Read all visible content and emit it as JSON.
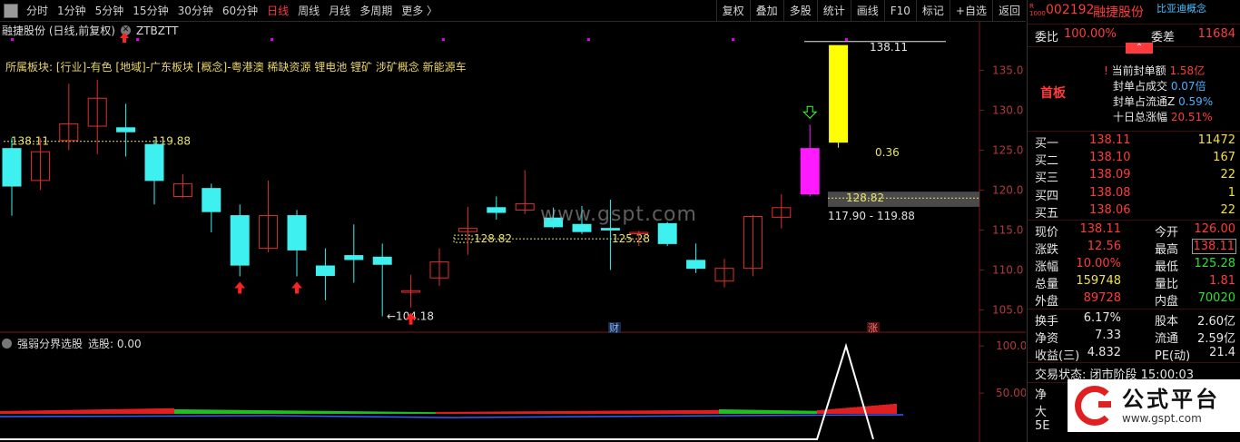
{
  "toolbar": {
    "periods": [
      "分时",
      "1分钟",
      "5分钟",
      "15分钟",
      "30分钟",
      "60分钟",
      "日线",
      "周线",
      "月线",
      "多周期",
      "更多 〉"
    ],
    "active_period": "日线",
    "tools": [
      "复权",
      "叠加",
      "多股",
      "统计",
      "画线",
      "F10",
      "标记",
      "+自选",
      "返回"
    ]
  },
  "chart": {
    "title": "融捷股份 (日线,前复权)",
    "indicator": "ZTBZTT",
    "blocks_text": "所属板块: [行业]-有色 [地域]-广东板块 [概念]-粤港澳 稀缺资源 锂电池 锂矿 涉矿概念 新能源车",
    "price_axis": [
      "135.0",
      "130.0",
      "125.0",
      "120.0",
      "115.0",
      "110.0",
      "105.0"
    ],
    "annotations": {
      "line_left_price": "138.11",
      "line_left_value": "119.88",
      "low_label": "←104.18",
      "mid_low": "128.82",
      "mid_high": "125.28",
      "band_price": "128.82",
      "band_range": "117.90 - 119.88",
      "top_label": "138.11",
      "gap_value": "0.36",
      "event_cai": "财",
      "event_zhang": "涨"
    },
    "watermark": "www.gspt.com"
  },
  "subchart": {
    "title": "强弱分界选股",
    "value_label": "选股: 0.00",
    "axis": [
      "100.0",
      "50.00"
    ]
  },
  "stock": {
    "code": "002192",
    "name": "融捷股份",
    "concept": "比亚迪概念",
    "badge": "R 1000",
    "weibi_label": "委比",
    "weibi": "100.00%",
    "weicha_label": "委差",
    "weicha": "11684",
    "limit_tag": "首板",
    "seal_amount_label": "当前封单额",
    "seal_amount": "1.58亿",
    "seal_deal_label": "封单占成交",
    "seal_deal": "0.07倍",
    "seal_float_label": "封单占流通Z",
    "seal_float": "0.59%",
    "ten_day_label": "十日总涨幅",
    "ten_day": "20.51%",
    "bids": [
      {
        "label": "买一",
        "price": "138.11",
        "vol": "11472"
      },
      {
        "label": "买二",
        "price": "138.10",
        "vol": "167"
      },
      {
        "label": "买三",
        "price": "138.09",
        "vol": "22"
      },
      {
        "label": "买四",
        "price": "138.08",
        "vol": "1"
      },
      {
        "label": "买五",
        "price": "138.06",
        "vol": "22"
      }
    ],
    "quote": [
      {
        "l1": "现价",
        "v1": "138.11",
        "l2": "今开",
        "v2": "126.00"
      },
      {
        "l1": "涨跌",
        "v1": "12.56",
        "l2": "最高",
        "v2": "138.11"
      },
      {
        "l1": "涨幅",
        "v1": "10.00%",
        "l2": "最低",
        "v2": "125.28"
      },
      {
        "l1": "总量",
        "v1": "159748",
        "l2": "量比",
        "v2": "1.81"
      },
      {
        "l1": "外盘",
        "v1": "89728",
        "l2": "内盘",
        "v2": "70020"
      }
    ],
    "fundamentals": [
      {
        "l1": "换手",
        "v1": "6.17%",
        "l2": "股本",
        "v2": "2.60亿"
      },
      {
        "l1": "净资",
        "v1": "7.33",
        "l2": "流通",
        "v2": "2.59亿"
      },
      {
        "l1": "收益(三)",
        "v1": "4.832",
        "l2": "PE(动)",
        "v2": "21.4"
      }
    ],
    "trade_status": "交易状态: 闭市阶段 15:00:03",
    "partial_rows": [
      "净",
      "大",
      "5E"
    ]
  },
  "logo": {
    "name": "公式平台",
    "url": "www.gspt.com"
  },
  "chart_data": {
    "type": "candlestick",
    "y_range": [
      103,
      139
    ],
    "candles": [
      {
        "o": 120.5,
        "c": 125.2,
        "h": 126.5,
        "l": 116.8,
        "dir": "down"
      },
      {
        "o": 121.2,
        "c": 124.8,
        "h": 126.5,
        "l": 120.0,
        "dir": "up"
      },
      {
        "o": 126.2,
        "c": 128.3,
        "h": 133.3,
        "l": 125.0,
        "dir": "up"
      },
      {
        "o": 128.0,
        "c": 131.5,
        "h": 133.8,
        "l": 124.5,
        "dir": "up"
      },
      {
        "o": 127.8,
        "c": 127.3,
        "h": 130.8,
        "l": 124.2,
        "dir": "down"
      },
      {
        "o": 125.7,
        "c": 121.2,
        "h": 126.3,
        "l": 118.2,
        "dir": "down"
      },
      {
        "o": 120.8,
        "c": 119.2,
        "h": 122.0,
        "l": 119.0,
        "dir": "up"
      },
      {
        "o": 120.2,
        "c": 117.3,
        "h": 120.8,
        "l": 114.7,
        "dir": "down"
      },
      {
        "o": 116.8,
        "c": 110.6,
        "h": 118.2,
        "l": 109.2,
        "dir": "down"
      },
      {
        "o": 112.7,
        "c": 116.8,
        "h": 121.2,
        "l": 112.2,
        "dir": "up"
      },
      {
        "o": 116.8,
        "c": 112.5,
        "h": 117.5,
        "l": 109.2,
        "dir": "down"
      },
      {
        "o": 110.5,
        "c": 109.3,
        "h": 112.7,
        "l": 106.2,
        "dir": "down"
      },
      {
        "o": 111.8,
        "c": 111.3,
        "h": 115.7,
        "l": 108.4,
        "dir": "down"
      },
      {
        "o": 111.6,
        "c": 110.7,
        "h": 113.3,
        "l": 104.2,
        "dir": "down"
      },
      {
        "o": 107.4,
        "c": 107.2,
        "h": 109.4,
        "l": 105.3,
        "dir": "up"
      },
      {
        "o": 109.0,
        "c": 111.0,
        "h": 112.7,
        "l": 108.0,
        "dir": "up"
      },
      {
        "o": 114.8,
        "c": 115.2,
        "h": 117.9,
        "l": 111.9,
        "dir": "up"
      },
      {
        "o": 117.8,
        "c": 117.2,
        "h": 119.2,
        "l": 116.3,
        "dir": "down"
      },
      {
        "o": 117.5,
        "c": 118.3,
        "h": 122.5,
        "l": 117.0,
        "dir": "up"
      },
      {
        "o": 116.5,
        "c": 115.4,
        "h": 117.8,
        "l": 115.2,
        "dir": "down"
      },
      {
        "o": 115.7,
        "c": 114.8,
        "h": 118.0,
        "l": 114.5,
        "dir": "down"
      },
      {
        "o": 115.2,
        "c": 115.0,
        "h": 118.8,
        "l": 110.0,
        "dir": "down"
      },
      {
        "o": 114.7,
        "c": 114.7,
        "h": 114.9,
        "l": 113.0,
        "dir": "up"
      },
      {
        "o": 115.8,
        "c": 113.3,
        "h": 116.0,
        "l": 113.0,
        "dir": "down"
      },
      {
        "o": 111.2,
        "c": 110.2,
        "h": 113.3,
        "l": 109.6,
        "dir": "down"
      },
      {
        "o": 108.6,
        "c": 110.2,
        "h": 111.4,
        "l": 107.8,
        "dir": "up"
      },
      {
        "o": 110.2,
        "c": 116.7,
        "h": 116.9,
        "l": 109.2,
        "dir": "up"
      },
      {
        "o": 116.6,
        "c": 117.8,
        "h": 119.5,
        "l": 115.2,
        "dir": "up"
      },
      {
        "o": 119.5,
        "c": 125.2,
        "h": 128.2,
        "l": 119.2,
        "dir": "magenta"
      },
      {
        "o": 126.0,
        "c": 138.1,
        "h": 138.1,
        "l": 125.3,
        "dir": "yellow"
      }
    ],
    "markers": {
      "up_arrows_at": [
        8,
        10,
        14
      ],
      "down_arrow_at": 28
    }
  }
}
